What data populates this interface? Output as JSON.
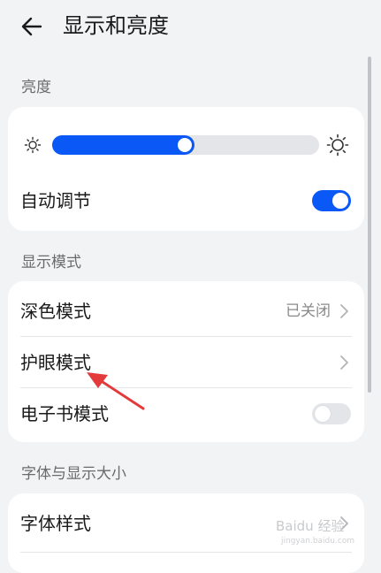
{
  "header": {
    "title": "显示和亮度"
  },
  "brightness": {
    "section_title": "亮度",
    "level": 0.5,
    "auto_label": "自动调节",
    "auto_on": true
  },
  "display_mode": {
    "section_title": "显示模式",
    "items": [
      {
        "label": "深色模式",
        "value": "已关闭"
      },
      {
        "label": "护眼模式"
      },
      {
        "label": "电子书模式",
        "toggle_on": false
      }
    ]
  },
  "font": {
    "section_title": "字体与显示大小",
    "items": [
      {
        "label": "字体样式"
      }
    ]
  },
  "watermark": {
    "text": "Baidu 经验",
    "sub": "jingyan.baidu.com"
  },
  "colors": {
    "accent": "#0a59f7",
    "annotation_arrow": "#e33b3b"
  }
}
